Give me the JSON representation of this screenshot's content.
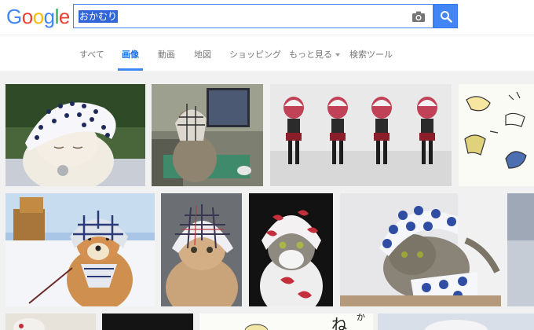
{
  "logo": {
    "letters": [
      "G",
      "o",
      "o",
      "g",
      "l",
      "e"
    ],
    "colors": [
      "#4285f4",
      "#ea4335",
      "#fbbc05",
      "#4285f4",
      "#34a853",
      "#ea4335"
    ]
  },
  "search": {
    "query": "おかむり",
    "selection_color": "#3367d6",
    "accent": "#4285f4"
  },
  "tabs": [
    {
      "label": "すべて",
      "active": false
    },
    {
      "label": "画像",
      "active": true
    },
    {
      "label": "動画",
      "active": false
    },
    {
      "label": "地図",
      "active": false
    },
    {
      "label": "ショッピング",
      "active": false
    },
    {
      "label": "もっと見る",
      "active": false
    },
    {
      "label": "検索ツール",
      "active": false
    }
  ],
  "images": {
    "row1": [
      "cat-polka-dot-headscarf",
      "cat-checkered-headscarf-at-desk",
      "anime-figure-rotation-views",
      "manga-illustration-partial"
    ],
    "row2": [
      "shiba-dog-in-snow-headscarf",
      "cat-plaid-headscarf",
      "cat-red-white-headscarf",
      "cat-blue-white-tenugui",
      "partial-image"
    ],
    "row3": [
      "partial-image",
      "partial-image",
      "manga-text-partial",
      "partial-image"
    ],
    "row3_text": [
      "ね",
      "か"
    ]
  }
}
